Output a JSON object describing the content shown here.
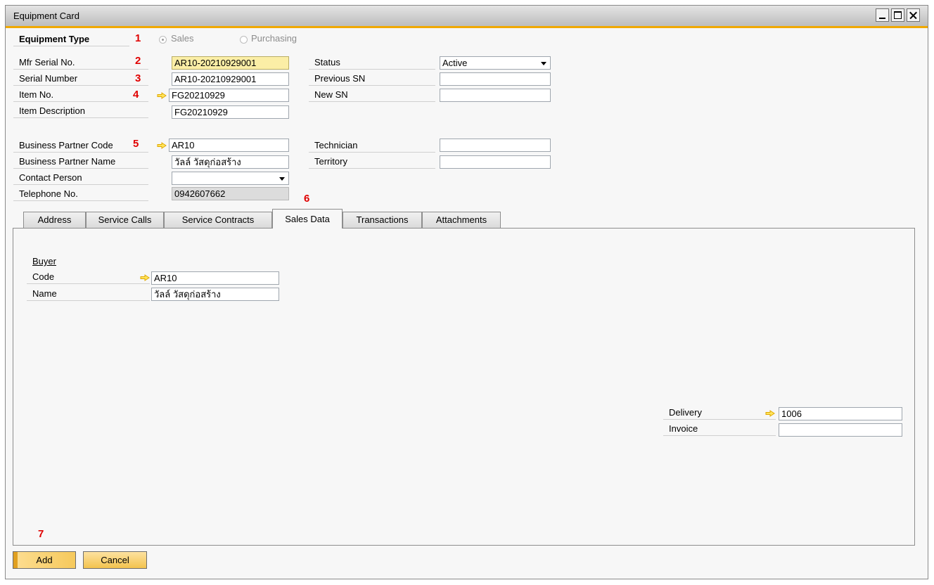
{
  "window": {
    "title": "Equipment Card"
  },
  "equipment_type": {
    "label": "Equipment Type",
    "options": [
      "Sales",
      "Purchasing"
    ],
    "selected": "Sales"
  },
  "header_fields": [
    {
      "label": "Mfr Serial No.",
      "value": "AR10-20210929001"
    },
    {
      "label": "Serial Number",
      "value": "AR10-20210929001"
    },
    {
      "label": "Item No.",
      "value": "FG20210929"
    },
    {
      "label": "Item Description",
      "value": "FG20210929"
    }
  ],
  "right_fields": [
    {
      "label": "Status",
      "value": "Active"
    },
    {
      "label": "Previous SN",
      "value": ""
    },
    {
      "label": "New SN",
      "value": ""
    }
  ],
  "partner_fields": [
    {
      "label": "Business Partner Code",
      "value": "AR10"
    },
    {
      "label": "Business Partner Name",
      "value": "วัลล์ วัสดุก่อสร้าง"
    },
    {
      "label": "Contact Person",
      "value": ""
    },
    {
      "label": "Telephone No.",
      "value": "0942607662"
    }
  ],
  "right_fields2": [
    {
      "label": "Technician",
      "value": ""
    },
    {
      "label": "Territory",
      "value": ""
    }
  ],
  "annotations": [
    "1",
    "2",
    "3",
    "4",
    "5",
    "6",
    "7"
  ],
  "tabs": [
    "Address",
    "Service Calls",
    "Service Contracts",
    "Sales Data",
    "Transactions",
    "Attachments"
  ],
  "active_tab": "Sales Data",
  "sales_data": {
    "buyer_heading": "Buyer",
    "code_label": "Code",
    "code_value": "AR10",
    "name_label": "Name",
    "name_value": "วัลล์ วัสดุก่อสร้าง",
    "delivery_label": "Delivery",
    "delivery_value": "1006",
    "invoice_label": "Invoice",
    "invoice_value": ""
  },
  "buttons": {
    "add": "Add",
    "cancel": "Cancel"
  },
  "colors": {
    "accent": "#f0a800",
    "annotation": "#e00000",
    "link_arrow": "#f0c000"
  }
}
